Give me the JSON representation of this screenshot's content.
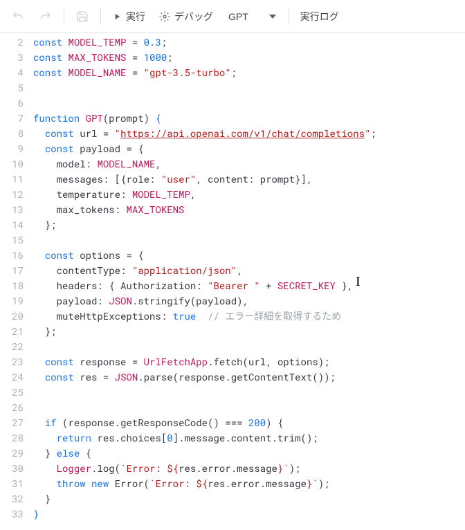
{
  "toolbar": {
    "run_label": "実行",
    "debug_label": "デバッグ",
    "select_value": "GPT",
    "log_label": "実行ログ"
  },
  "line_numbers": [
    "2",
    "3",
    "4",
    "5",
    "6",
    "7",
    "8",
    "9",
    "10",
    "11",
    "12",
    "13",
    "14",
    "15",
    "16",
    "17",
    "18",
    "19",
    "20",
    "21",
    "22",
    "23",
    "24",
    "25",
    "26",
    "27",
    "28",
    "29",
    "30",
    "31",
    "32",
    "33"
  ],
  "code": {
    "MODEL_TEMP_name": "MODEL_TEMP",
    "MODEL_TEMP_val": "0.3",
    "MAX_TOKENS_name": "MAX_TOKENS",
    "MAX_TOKENS_val": "1000",
    "MODEL_NAME_name": "MODEL_NAME",
    "MODEL_NAME_val": "\"gpt-3.5-turbo\"",
    "fn_name": "GPT",
    "fn_param": "prompt",
    "url_val": "https://api.openai.com/v1/chat/completions",
    "role_val": "\"user\"",
    "contentType_val": "\"application/json\"",
    "bearer_val": "\"Bearer \"",
    "SECRET_KEY": "SECRET_KEY",
    "mute_val": "true",
    "mute_comment": "// エラー詳細を取得するため",
    "two_hundred": "200",
    "zero": "0",
    "err_tpl1": "`Error: ${",
    "err_tpl2": "res.error.message",
    "err_tpl3": "}`",
    "kw_const": "const",
    "kw_function": "function",
    "kw_if": "if",
    "kw_else": "else",
    "kw_return": "return",
    "kw_throw": "throw",
    "kw_new": "new",
    "id_url": "url",
    "id_payload": "payload",
    "id_model": "model",
    "id_messages": "messages",
    "id_role": "role",
    "id_content": "content",
    "id_temperature": "temperature",
    "id_max_tokens": "max_tokens",
    "id_options": "options",
    "id_contentType": "contentType",
    "id_headers": "headers",
    "id_Authorization": "Authorization",
    "id_payload2": "payload",
    "id_JSON": "JSON",
    "id_stringify": "stringify",
    "id_muteHttp": "muteHttpExceptions",
    "id_response": "response",
    "id_UrlFetchApp": "UrlFetchApp",
    "id_fetch": "fetch",
    "id_res": "res",
    "id_parse": "parse",
    "id_getContentText": "getContentText",
    "id_getResponseCode": "getResponseCode",
    "id_choices": "choices",
    "id_message": "message",
    "id_trim": "trim",
    "id_Logger": "Logger",
    "id_log": "log",
    "id_Error": "Error"
  }
}
